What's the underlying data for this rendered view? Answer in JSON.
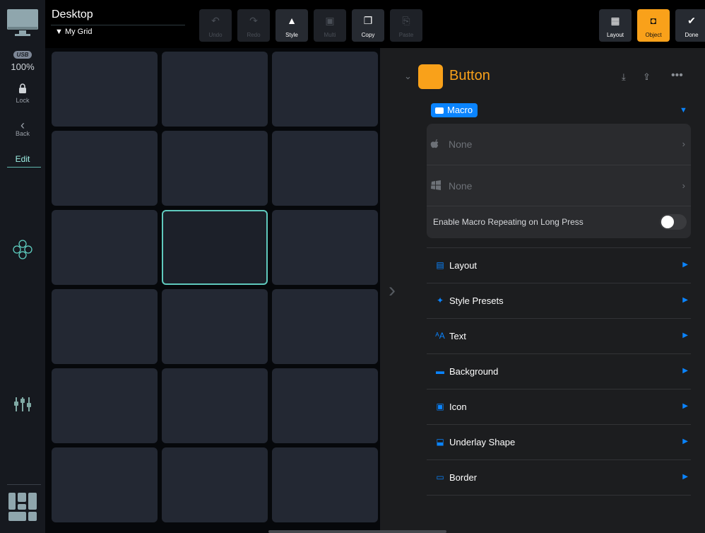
{
  "header": {
    "title": "Desktop",
    "grid_name": "▼ My Grid",
    "toolbar": [
      {
        "key": "undo",
        "label": "Undo",
        "icon": "undo-icon",
        "glyph": "↶",
        "enabled": false
      },
      {
        "key": "redo",
        "label": "Redo",
        "icon": "redo-icon",
        "glyph": "↷",
        "enabled": false
      },
      {
        "key": "style",
        "label": "Style",
        "icon": "brush-icon",
        "glyph": "▲",
        "enabled": true
      },
      {
        "key": "multi",
        "label": "Multi",
        "icon": "multi-select-icon",
        "glyph": "▣",
        "enabled": false
      },
      {
        "key": "copy",
        "label": "Copy",
        "icon": "copy-icon",
        "glyph": "❐",
        "enabled": true
      },
      {
        "key": "paste",
        "label": "Paste",
        "icon": "paste-icon",
        "glyph": "⎘",
        "enabled": false
      }
    ],
    "right_buttons": [
      {
        "key": "layout",
        "label": "Layout",
        "icon": "layout-icon",
        "glyph": "▦"
      },
      {
        "key": "object",
        "label": "Object",
        "icon": "object-icon",
        "glyph": "◘",
        "active": true
      },
      {
        "key": "done",
        "label": "Done",
        "icon": "checkmark-icon",
        "glyph": "✔"
      }
    ]
  },
  "sidebar": {
    "connection": "USB",
    "zoom": "100%",
    "lock_label": "Lock",
    "back_label": "Back",
    "edit_label": "Edit"
  },
  "grid": {
    "rows": 6,
    "cols": 3,
    "selected": [
      2,
      1
    ]
  },
  "panel": {
    "object_title": "Button",
    "object_color": "#f9a11a",
    "macro_label": "Macro",
    "mac_macro": "None",
    "win_macro": "None",
    "repeat_label": "Enable Macro Repeating on Long Press",
    "repeat_enabled": false,
    "sections": [
      {
        "label": "Layout",
        "icon": "layout-section-icon"
      },
      {
        "label": "Style Presets",
        "icon": "pin-icon"
      },
      {
        "label": "Text",
        "icon": "text-size-icon"
      },
      {
        "label": "Background",
        "icon": "background-icon"
      },
      {
        "label": "Icon",
        "icon": "image-icon"
      },
      {
        "label": "Underlay Shape",
        "icon": "underlay-shape-icon"
      },
      {
        "label": "Border",
        "icon": "border-icon"
      }
    ]
  },
  "colors": {
    "accent": "#f9a11a",
    "link": "#0a84ff",
    "teal": "#5fc9bd"
  }
}
